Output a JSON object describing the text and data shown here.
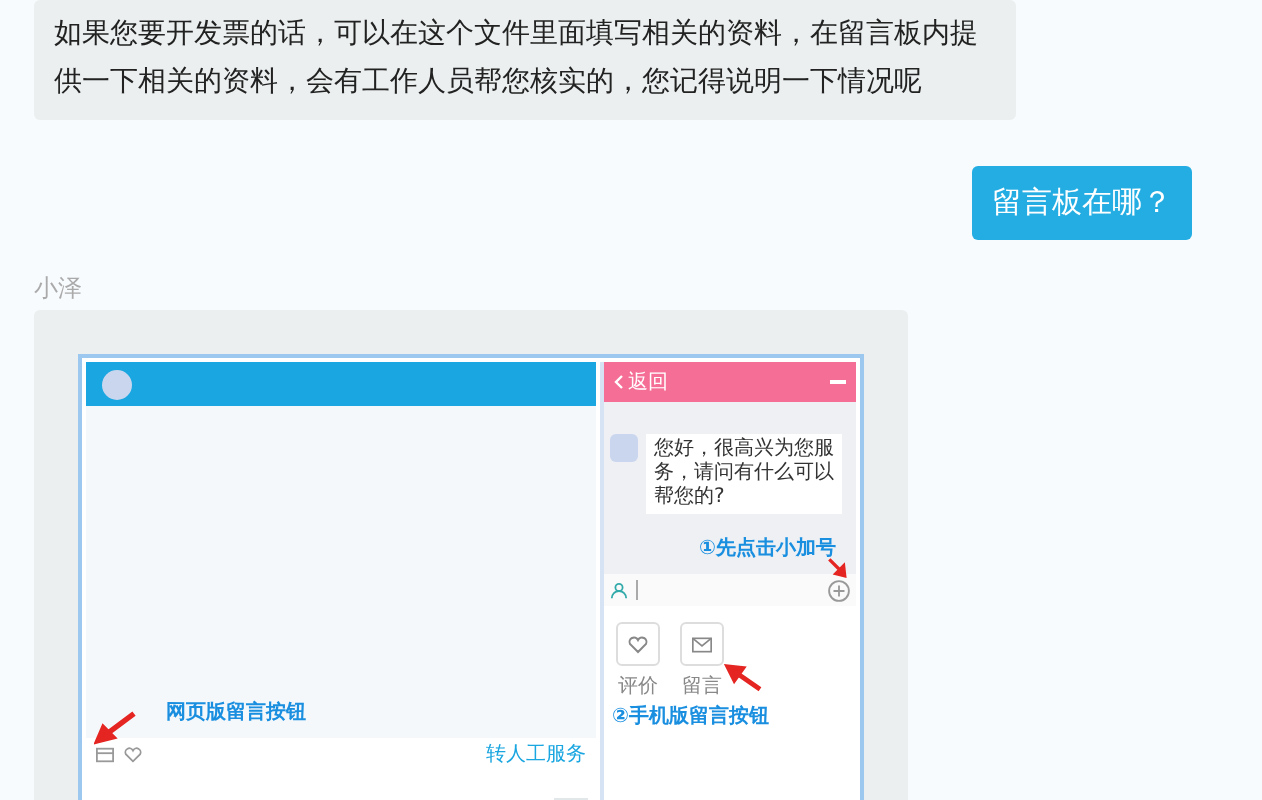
{
  "agent_message": {
    "text": "如果您要开发票的话，可以在这个文件里面填写相关的资料，在留言板内提供一下相关的资料，会有工作人员帮您核实的，您记得说明一下情况呢"
  },
  "user_message": {
    "text": "留言板在哪？"
  },
  "image_message": {
    "sender": "小泽",
    "web_chat": {
      "transfer_link": "转人工服务",
      "annotation": "网页版留言按钮"
    },
    "mobile_chat": {
      "back": "返回",
      "greeting": "您好，很高兴为您服务，请问有什么可以帮您的?",
      "annotation_plus": "①先点击小加号",
      "actions": [
        {
          "kind": "rate",
          "label": "评价"
        },
        {
          "kind": "message",
          "label": "留言"
        }
      ],
      "annotation_message": "②手机版留言按钮"
    }
  }
}
